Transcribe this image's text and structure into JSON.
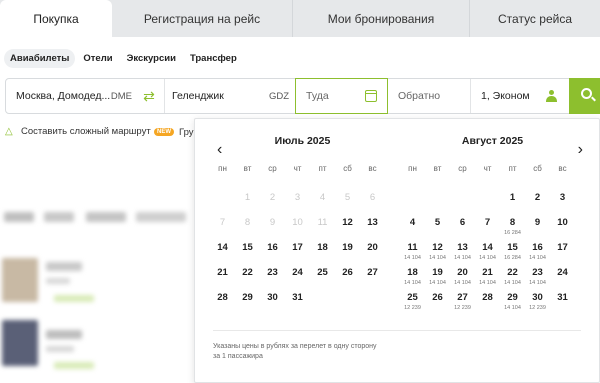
{
  "tabs": [
    "Покупка",
    "Регистрация на рейс",
    "Мои бронирования",
    "Статус рейса"
  ],
  "subtabs": [
    "Авиабилеты",
    "Отели",
    "Экскурсии",
    "Трансфер"
  ],
  "search": {
    "from_city": "Москва, Домодед...",
    "from_code": "DME",
    "to_city": "Геленджик",
    "to_code": "GDZ",
    "date_placeholder": "Туда",
    "return_placeholder": "Обратно",
    "passengers": "1, Эконом"
  },
  "icons": {
    "swap": "swap-arrows-icon",
    "calendar": "calendar-icon",
    "person": "person-icon",
    "search": "search-icon",
    "route": "route-icon"
  },
  "route": {
    "link": "Составить сложный маршрут",
    "badge": "NEW",
    "groups": "Гру"
  },
  "calendar": {
    "weekdays": [
      "пн",
      "вт",
      "ср",
      "чт",
      "пт",
      "сб",
      "вс"
    ],
    "months": [
      {
        "title": "Июль 2025",
        "days": [
          {
            "d": "",
            "p": ""
          },
          {
            "d": "1",
            "p": "",
            "off": true
          },
          {
            "d": "2",
            "p": "",
            "off": true
          },
          {
            "d": "3",
            "p": "",
            "off": true
          },
          {
            "d": "4",
            "p": "",
            "off": true
          },
          {
            "d": "5",
            "p": "",
            "off": true
          },
          {
            "d": "6",
            "p": "",
            "off": true
          },
          {
            "d": "7",
            "p": "",
            "off": true
          },
          {
            "d": "8",
            "p": "",
            "off": true
          },
          {
            "d": "9",
            "p": "",
            "off": true
          },
          {
            "d": "10",
            "p": "",
            "off": true
          },
          {
            "d": "11",
            "p": "",
            "off": true
          },
          {
            "d": "12",
            "p": ""
          },
          {
            "d": "13",
            "p": ""
          },
          {
            "d": "14",
            "p": ""
          },
          {
            "d": "15",
            "p": ""
          },
          {
            "d": "16",
            "p": ""
          },
          {
            "d": "17",
            "p": ""
          },
          {
            "d": "18",
            "p": ""
          },
          {
            "d": "19",
            "p": ""
          },
          {
            "d": "20",
            "p": ""
          },
          {
            "d": "21",
            "p": ""
          },
          {
            "d": "22",
            "p": ""
          },
          {
            "d": "23",
            "p": ""
          },
          {
            "d": "24",
            "p": ""
          },
          {
            "d": "25",
            "p": ""
          },
          {
            "d": "26",
            "p": ""
          },
          {
            "d": "27",
            "p": ""
          },
          {
            "d": "28",
            "p": ""
          },
          {
            "d": "29",
            "p": ""
          },
          {
            "d": "30",
            "p": ""
          },
          {
            "d": "31",
            "p": ""
          }
        ]
      },
      {
        "title": "Август 2025",
        "days": [
          {
            "d": "",
            "p": ""
          },
          {
            "d": "",
            "p": ""
          },
          {
            "d": "",
            "p": ""
          },
          {
            "d": "",
            "p": ""
          },
          {
            "d": "1",
            "p": ""
          },
          {
            "d": "2",
            "p": ""
          },
          {
            "d": "3",
            "p": ""
          },
          {
            "d": "4",
            "p": ""
          },
          {
            "d": "5",
            "p": ""
          },
          {
            "d": "6",
            "p": ""
          },
          {
            "d": "7",
            "p": ""
          },
          {
            "d": "8",
            "p": "16 284"
          },
          {
            "d": "9",
            "p": ""
          },
          {
            "d": "10",
            "p": ""
          },
          {
            "d": "11",
            "p": "14 104"
          },
          {
            "d": "12",
            "p": "14 104"
          },
          {
            "d": "13",
            "p": "14 104"
          },
          {
            "d": "14",
            "p": "14 104"
          },
          {
            "d": "15",
            "p": "16 284"
          },
          {
            "d": "16",
            "p": "14 104"
          },
          {
            "d": "17",
            "p": ""
          },
          {
            "d": "18",
            "p": "14 104"
          },
          {
            "d": "19",
            "p": "14 104"
          },
          {
            "d": "20",
            "p": "14 104"
          },
          {
            "d": "21",
            "p": "14 104"
          },
          {
            "d": "22",
            "p": "14 104"
          },
          {
            "d": "23",
            "p": "14 104"
          },
          {
            "d": "24",
            "p": ""
          },
          {
            "d": "25",
            "p": "12 239"
          },
          {
            "d": "26",
            "p": ""
          },
          {
            "d": "27",
            "p": "12 239"
          },
          {
            "d": "28",
            "p": ""
          },
          {
            "d": "29",
            "p": "14 104"
          },
          {
            "d": "30",
            "p": "12 239"
          },
          {
            "d": "31",
            "p": ""
          }
        ]
      }
    ],
    "note": "Указаны цены в рублях за перелет в одну сторону за 1 пассажира"
  },
  "colors": {
    "accent": "#8dbf2e",
    "badge": "#f5a623"
  }
}
